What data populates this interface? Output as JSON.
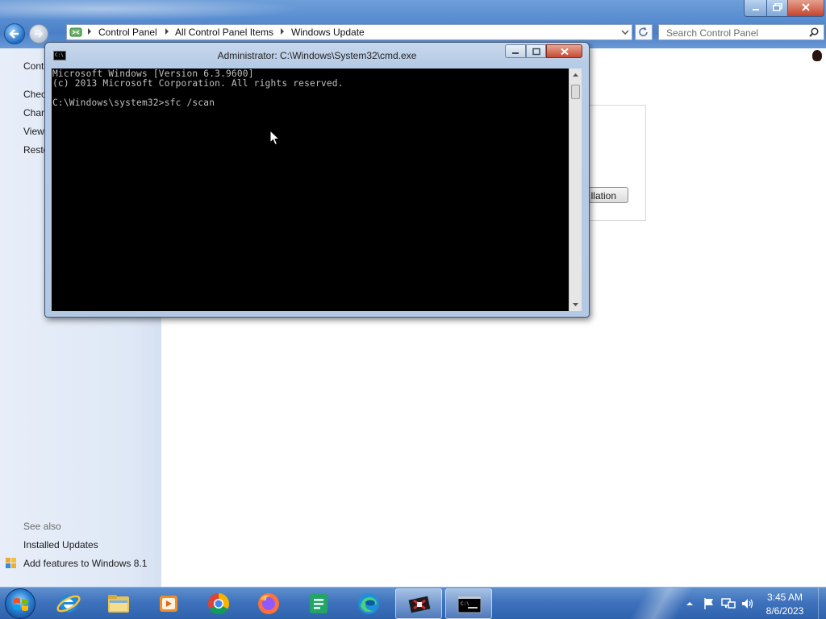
{
  "explorer": {
    "breadcrumbs": [
      "Control Panel",
      "All Control Panel Items",
      "Windows Update"
    ],
    "search_placeholder": "Search Control Panel",
    "left_nav": {
      "links": [
        "Cont",
        "Chec",
        "Char",
        "View",
        "Resto"
      ],
      "see_also_label": "See also",
      "see_also_links": [
        "Installed Updates",
        "Add features to Windows 8.1"
      ]
    },
    "install_button_label": "llation"
  },
  "cmd_window": {
    "title": "Administrator: C:\\Windows\\System32\\cmd.exe",
    "icon_text": "C:\\",
    "console_lines": [
      "Microsoft Windows [Version 6.3.9600]",
      "(c) 2013 Microsoft Corporation. All rights reserved.",
      "",
      "C:\\Windows\\system32>sfc /scan"
    ]
  },
  "taskbar": {
    "apps": [
      {
        "name": "Internet Explorer",
        "icon": "ie-icon"
      },
      {
        "name": "File Explorer",
        "icon": "folder-icon"
      },
      {
        "name": "Media Player",
        "icon": "media-player-icon"
      },
      {
        "name": "Google Chrome",
        "icon": "chrome-icon"
      },
      {
        "name": "Firefox",
        "icon": "firefox-icon"
      },
      {
        "name": "Spreadsheet",
        "icon": "spreadsheet-icon"
      },
      {
        "name": "Microsoft Edge",
        "icon": "edge-icon"
      },
      {
        "name": "Game",
        "icon": "game-icon"
      },
      {
        "name": "Command Prompt",
        "icon": "cmd-icon"
      }
    ],
    "clock": {
      "time": "3:45 AM",
      "date": "8/6/2023"
    }
  },
  "colors": {
    "console_bg": "#000000",
    "console_text": "#c0c0c0",
    "taskbar": "#3f73bd",
    "left_nav_bg": "#e7eef9"
  }
}
